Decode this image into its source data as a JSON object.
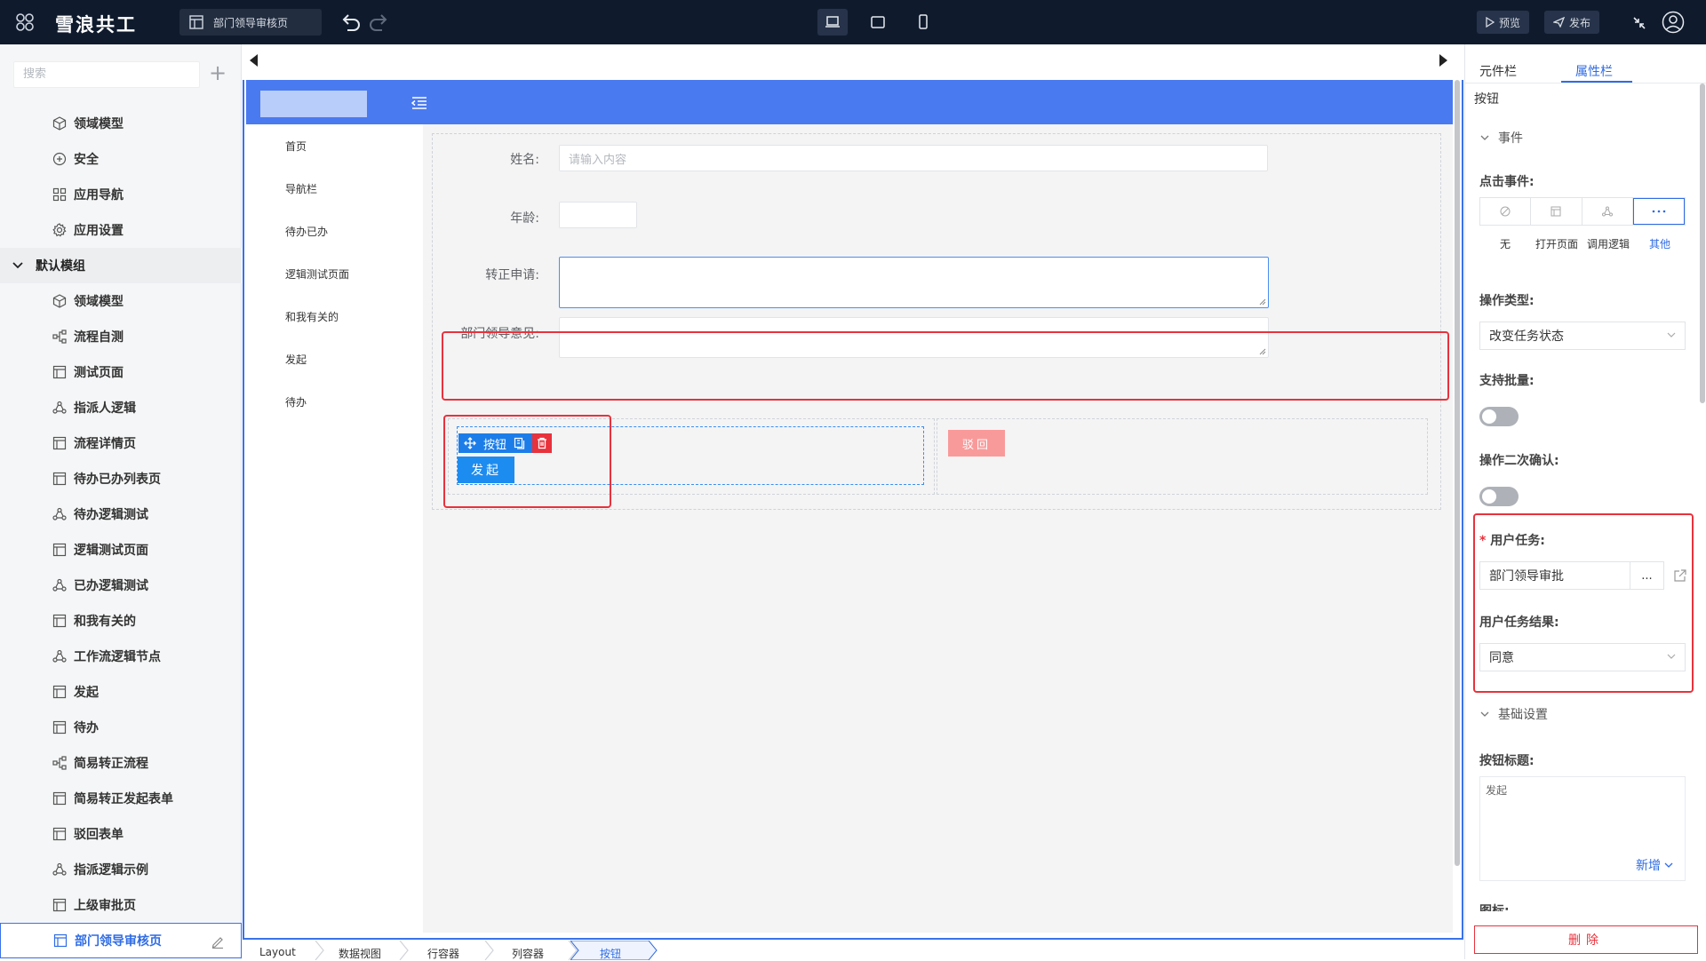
{
  "topbar": {
    "brand": "雪浪共工",
    "page_tab": "部门领导审核页",
    "preview_label": "预览",
    "publish_label": "发布"
  },
  "left_panel": {
    "search_placeholder": "搜索",
    "items_top": [
      {
        "icon": "cube-icon",
        "label": "领域模型"
      },
      {
        "icon": "shield-plus-icon",
        "label": "安全"
      },
      {
        "icon": "grid-icon",
        "label": "应用导航"
      },
      {
        "icon": "gear-icon",
        "label": "应用设置"
      }
    ],
    "group_label": "默认模组",
    "items": [
      {
        "icon": "cube-icon",
        "label": "领域模型"
      },
      {
        "icon": "flow-icon",
        "label": "流程自测"
      },
      {
        "icon": "page-icon",
        "label": "测试页面"
      },
      {
        "icon": "logic-icon",
        "label": "指派人逻辑"
      },
      {
        "icon": "page-icon",
        "label": "流程详情页"
      },
      {
        "icon": "page-icon",
        "label": "待办已办列表页"
      },
      {
        "icon": "logic-icon",
        "label": "待办逻辑测试"
      },
      {
        "icon": "page-icon",
        "label": "逻辑测试页面"
      },
      {
        "icon": "logic-icon",
        "label": "已办逻辑测试"
      },
      {
        "icon": "page-icon",
        "label": "和我有关的"
      },
      {
        "icon": "logic-icon",
        "label": "工作流逻辑节点"
      },
      {
        "icon": "page-icon",
        "label": "发起"
      },
      {
        "icon": "page-icon",
        "label": "待办"
      },
      {
        "icon": "flow-icon",
        "label": "简易转正流程"
      },
      {
        "icon": "page-icon",
        "label": "简易转正发起表单"
      },
      {
        "icon": "page-icon",
        "label": "驳回表单"
      },
      {
        "icon": "logic-icon",
        "label": "指派逻辑示例"
      },
      {
        "icon": "page-icon",
        "label": "上级审批页"
      }
    ],
    "selected_item": "部门领导审核页"
  },
  "app": {
    "nav": [
      "首页",
      "导航栏",
      "待办已办",
      "逻辑测试页面",
      "和我有关的",
      "发起",
      "待办"
    ],
    "form": {
      "name_label": "姓名:",
      "name_placeholder": "请输入内容",
      "age_label": "年龄:",
      "apply_label": "转正申请:",
      "opinion_label": "部门领导意见:"
    },
    "selected_component_label": "按钮",
    "launch_button": "发起",
    "reject_button": "驳回"
  },
  "breadcrumb": [
    "Layout",
    "数据视图",
    "行容器",
    "列容器",
    "按钮"
  ],
  "right_panel": {
    "tabs": [
      "元件栏",
      "属性栏"
    ],
    "active_tab": "属性栏",
    "component_title": "按钮",
    "events_section": "事件",
    "click_event_label": "点击事件:",
    "event_options": [
      "无",
      "打开页面",
      "调用逻辑",
      "其他"
    ],
    "event_selected": "其他",
    "operation_type_label": "操作类型:",
    "operation_type_value": "改变任务状态",
    "batch_label": "支持批量:",
    "confirm_label": "操作二次确认:",
    "user_task_label": "用户任务:",
    "user_task_value": "部门领导审批",
    "user_task_more": "...",
    "task_result_label": "用户任务结果:",
    "task_result_value": "同意",
    "basic_section": "基础设置",
    "button_title_label": "按钮标题:",
    "button_title_value": "发起",
    "add_new": "新增",
    "next_label_partial": "图标:",
    "delete_button": "删除"
  },
  "colors": {
    "accent": "#2f6ce5",
    "header_blue": "#4a7af0",
    "danger": "#e8323c",
    "topbar": "#0f1b2d"
  }
}
